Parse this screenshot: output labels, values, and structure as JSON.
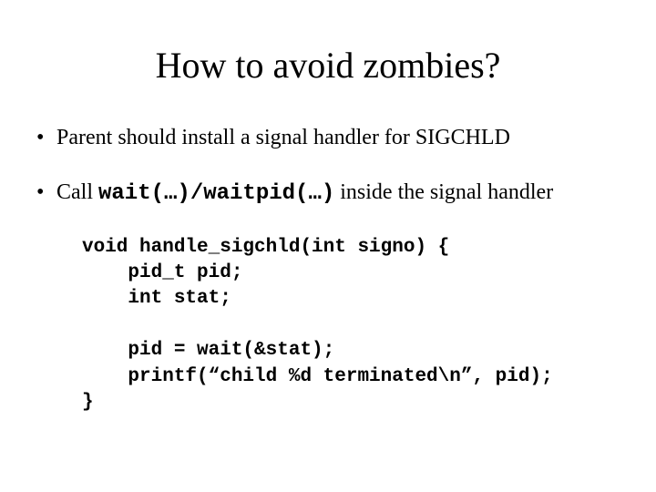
{
  "title": "How to avoid zombies?",
  "bullets": {
    "b1": "Parent should install a signal handler for SIGCHLD",
    "b2_pre": "Call ",
    "b2_code": "wait(…)/waitpid(…)",
    "b2_post": " inside the signal handler"
  },
  "code": "void handle_sigchld(int signo) {\n    pid_t pid;\n    int stat;\n\n    pid = wait(&stat);\n    printf(“child %d terminated\\n”, pid);\n}"
}
